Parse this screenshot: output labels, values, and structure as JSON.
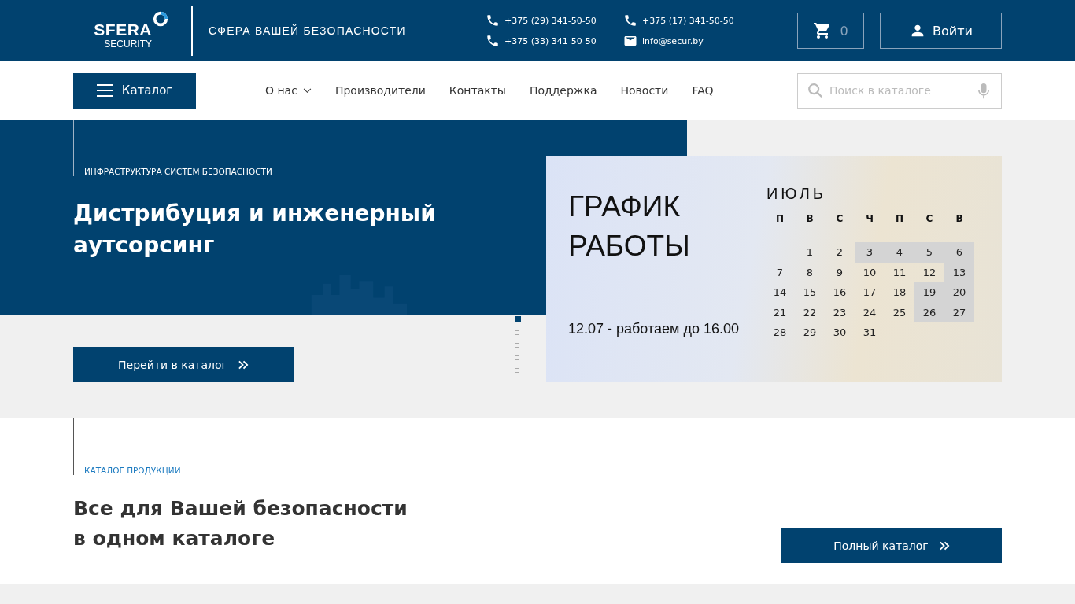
{
  "header": {
    "logo": {
      "word": "SFERA",
      "sub": "SECURITY"
    },
    "slogan": "СФЕРА ВАШЕЙ БЕЗОПАСНОСТИ",
    "contacts": [
      {
        "kind": "phone",
        "text": "+375 (29) 341-50-50"
      },
      {
        "kind": "phone",
        "text": "+375 (17) 341-50-50"
      },
      {
        "kind": "phone",
        "text": "+375 (33) 341-50-50"
      },
      {
        "kind": "email",
        "text": "info@secur.by"
      }
    ],
    "cart_count": "0",
    "login": "Войти"
  },
  "nav": {
    "catalog_button": "Каталог",
    "items": [
      {
        "label": "О нас",
        "dropdown": true
      },
      {
        "label": "Производители",
        "dropdown": false
      },
      {
        "label": "Контакты",
        "dropdown": false
      },
      {
        "label": "Поддержка",
        "dropdown": false
      },
      {
        "label": "Новости",
        "dropdown": false
      },
      {
        "label": "FAQ",
        "dropdown": false
      }
    ],
    "search": {
      "placeholder": "Поиск в каталоге"
    }
  },
  "hero": {
    "eyebrow": "ИНФРАСТРУКТУРА СИСТЕМ БЕЗОПАСНОСТИ",
    "title": "Дистрибуция и инженерный аутсорсинг",
    "button": "Перейти в каталог",
    "slides": [
      {
        "selected": true
      },
      {
        "selected": false
      },
      {
        "selected": false
      },
      {
        "selected": false
      },
      {
        "selected": false
      }
    ],
    "banner": {
      "title_lines": [
        "ГРАФИК",
        "РАБОТЫ"
      ],
      "note": "12.07 - работаем до 16.00",
      "month": "ИЮЛЬ",
      "weekdays": [
        "П",
        "В",
        "С",
        "Ч",
        "П",
        "С",
        "В"
      ],
      "weeks": [
        {
          "days": [
            {
              "text": "1",
              "off": false
            },
            {
              "text": "2",
              "off": false
            },
            {
              "text": "3",
              "off": true
            },
            {
              "text": "4",
              "off": true
            },
            {
              "text": "5",
              "off": true
            },
            {
              "text": "6",
              "off": true
            }
          ]
        },
        {
          "days": [
            {
              "text": "7",
              "off": false
            },
            {
              "text": "8",
              "off": false
            },
            {
              "text": "9",
              "off": false
            },
            {
              "text": "10",
              "off": false
            },
            {
              "text": "11",
              "off": false
            },
            {
              "text": "12",
              "off": false
            },
            {
              "text": "13",
              "off": true
            }
          ]
        },
        {
          "days": [
            {
              "text": "14",
              "off": false
            },
            {
              "text": "15",
              "off": false
            },
            {
              "text": "16",
              "off": false
            },
            {
              "text": "17",
              "off": false
            },
            {
              "text": "18",
              "off": false
            },
            {
              "text": "19",
              "off": true
            },
            {
              "text": "20",
              "off": true
            }
          ]
        },
        {
          "days": [
            {
              "text": "21",
              "off": false
            },
            {
              "text": "22",
              "off": false
            },
            {
              "text": "23",
              "off": false
            },
            {
              "text": "24",
              "off": false
            },
            {
              "text": "25",
              "off": false
            },
            {
              "text": "26",
              "off": true
            },
            {
              "text": "27",
              "off": true
            }
          ]
        },
        {
          "days": [
            {
              "text": "28",
              "off": false
            },
            {
              "text": "29",
              "off": false
            },
            {
              "text": "30",
              "off": false
            },
            {
              "text": "31",
              "off": false
            }
          ]
        }
      ]
    }
  },
  "catalog": {
    "eyebrow": "КАТАЛОГ ПРОДУКЦИИ",
    "title_lines": [
      "Все для Вашей безопасности",
      "в одном каталоге"
    ],
    "button": "Полный каталог"
  }
}
